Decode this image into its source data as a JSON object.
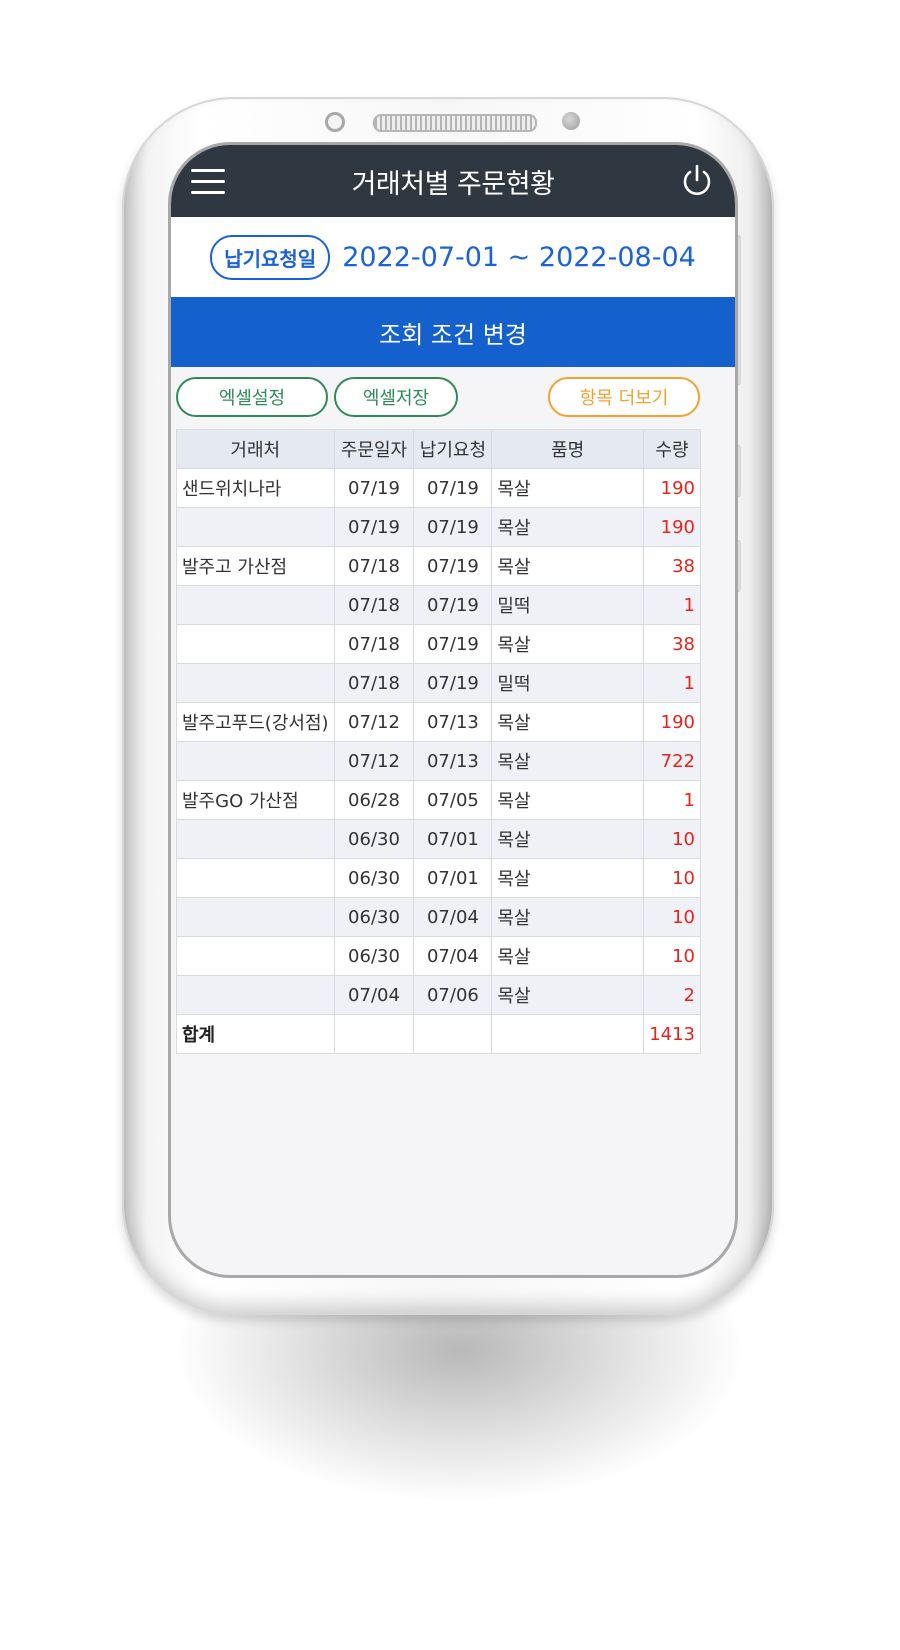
{
  "header": {
    "title": "거래처별 주문현황"
  },
  "period": {
    "badge_label": "납기요청일",
    "range": "2022-07-01 ~ 2022-08-04"
  },
  "actions": {
    "change_label": "조회 조건 변경",
    "excel_settings": "엑셀설정",
    "excel_save": "엑셀저장",
    "more_columns": "항목 더보기"
  },
  "table": {
    "headers": [
      "거래처",
      "주문일자",
      "납기요청",
      "품명",
      "수량"
    ],
    "rows": [
      [
        "샌드위치나라",
        "07/19",
        "07/19",
        "목살",
        "190"
      ],
      [
        "",
        "07/19",
        "07/19",
        "목살",
        "190"
      ],
      [
        "발주고 가산점",
        "07/18",
        "07/19",
        "목살",
        "38"
      ],
      [
        "",
        "07/18",
        "07/19",
        "밀떡",
        "1"
      ],
      [
        "",
        "07/18",
        "07/19",
        "목살",
        "38"
      ],
      [
        "",
        "07/18",
        "07/19",
        "밀떡",
        "1"
      ],
      [
        "발주고푸드(강서점)",
        "07/12",
        "07/13",
        "목살",
        "190"
      ],
      [
        "",
        "07/12",
        "07/13",
        "목살",
        "722"
      ],
      [
        "발주GO 가산점",
        "06/28",
        "07/05",
        "목살",
        "1"
      ],
      [
        "",
        "06/30",
        "07/01",
        "목살",
        "10"
      ],
      [
        "",
        "06/30",
        "07/01",
        "목살",
        "10"
      ],
      [
        "",
        "06/30",
        "07/04",
        "목살",
        "10"
      ],
      [
        "",
        "06/30",
        "07/04",
        "목살",
        "10"
      ],
      [
        "",
        "07/04",
        "07/06",
        "목살",
        "2"
      ]
    ],
    "total_label": "합계",
    "total_value": "1413"
  },
  "colors": {
    "topbar": "#2f3841",
    "accent_blue": "#1460cc",
    "quantity_red": "#e8231b",
    "excel_green": "#2e8b57",
    "more_orange": "#f3a12f"
  },
  "icons": {
    "menu": "hamburger-menu-icon",
    "power": "power-icon"
  }
}
